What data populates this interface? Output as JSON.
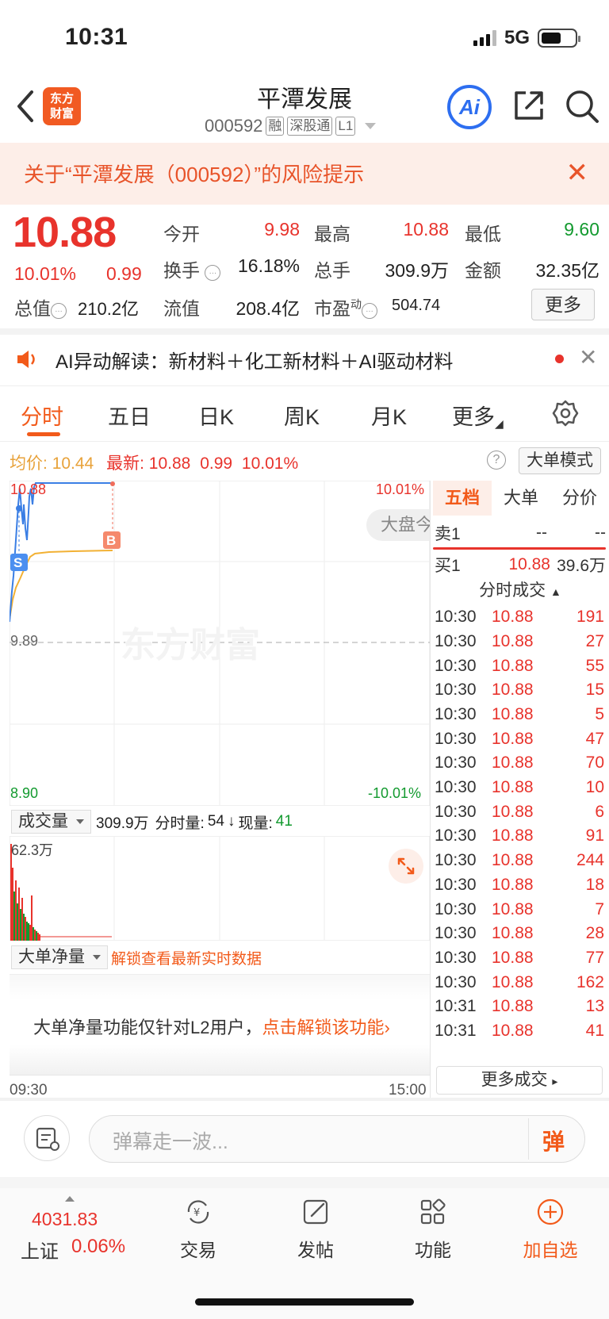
{
  "status_bar": {
    "time": "10:31",
    "network": "5G"
  },
  "header": {
    "logo": "东方财富",
    "stock_name": "平潭发展",
    "stock_code": "000592",
    "tags": [
      "融",
      "深股通",
      "L1"
    ],
    "ai_label": "Ai"
  },
  "risk_banner": {
    "text": "关于“平潭发展（000592）”的风险提示"
  },
  "quote": {
    "price": "10.88",
    "change_pct": "10.01%",
    "change": "0.99",
    "fields": [
      {
        "label": "今开",
        "value": "9.98",
        "color": "red"
      },
      {
        "label": "最高",
        "value": "10.88",
        "color": "red"
      },
      {
        "label": "最低",
        "value": "9.60",
        "color": "green"
      },
      {
        "label": "换手",
        "value": "16.18%",
        "color": "black"
      },
      {
        "label": "总手",
        "value": "309.9万",
        "color": "black"
      },
      {
        "label": "金额",
        "value": "32.35亿",
        "color": "black"
      },
      {
        "label": "总值",
        "value": "210.2亿",
        "color": "black"
      },
      {
        "label": "流值",
        "value": "208.4亿",
        "color": "black"
      },
      {
        "label": "市盈",
        "label_sup": "动",
        "value": "504.74",
        "color": "black"
      }
    ],
    "more_label": "更多"
  },
  "ai_notice": {
    "text": "AI异动解读：新材料＋化工新材料＋AI驱动材料"
  },
  "tabs": [
    "分时",
    "五日",
    "日K",
    "周K",
    "月K",
    "更多"
  ],
  "avg_row": {
    "avg_label": "均价:",
    "avg_value": "10.44",
    "latest_label": "最新:",
    "latest_value": "10.88",
    "change": "0.99",
    "change_pct": "10.01%",
    "mode_label": "大单模式"
  },
  "chart": {
    "y_top": "10.88",
    "y_mid": "9.89",
    "y_bottom": "8.90",
    "pct_top": "10.01%",
    "pct_bottom": "-10.01%",
    "watermark": "东方财富",
    "marker_b": "B",
    "marker_s": "S",
    "dapan_label": "大盘今"
  },
  "volume": {
    "selector": "成交量",
    "total": "309.9万",
    "fenshi_label": "分时量:",
    "fenshi_value": "54",
    "current_label": "现量:",
    "current_value": "41",
    "max_label": "62.3万"
  },
  "net_flow": {
    "selector": "大单净量",
    "unlock_text": "解锁查看最新实时数据",
    "l2_text": "大单净量功能仅针对L2用户，",
    "l2_link": "点击解锁该功能"
  },
  "time_axis": {
    "start": "09:30",
    "end": "15:00"
  },
  "right_panel": {
    "tabs": [
      "五档",
      "大单",
      "分价"
    ],
    "sell1": {
      "label": "卖1",
      "price": "--",
      "volume": "--"
    },
    "buy1": {
      "label": "买1",
      "price": "10.88",
      "volume": "39.6万"
    },
    "ticks_header": "分时成交",
    "ticks": [
      {
        "time": "10:30",
        "price": "10.88",
        "vol": "191"
      },
      {
        "time": "10:30",
        "price": "10.88",
        "vol": "27"
      },
      {
        "time": "10:30",
        "price": "10.88",
        "vol": "55"
      },
      {
        "time": "10:30",
        "price": "10.88",
        "vol": "15"
      },
      {
        "time": "10:30",
        "price": "10.88",
        "vol": "5"
      },
      {
        "time": "10:30",
        "price": "10.88",
        "vol": "47"
      },
      {
        "time": "10:30",
        "price": "10.88",
        "vol": "70"
      },
      {
        "time": "10:30",
        "price": "10.88",
        "vol": "10"
      },
      {
        "time": "10:30",
        "price": "10.88",
        "vol": "6"
      },
      {
        "time": "10:30",
        "price": "10.88",
        "vol": "91"
      },
      {
        "time": "10:30",
        "price": "10.88",
        "vol": "244"
      },
      {
        "time": "10:30",
        "price": "10.88",
        "vol": "18"
      },
      {
        "time": "10:30",
        "price": "10.88",
        "vol": "7"
      },
      {
        "time": "10:30",
        "price": "10.88",
        "vol": "28"
      },
      {
        "time": "10:30",
        "price": "10.88",
        "vol": "77"
      },
      {
        "time": "10:30",
        "price": "10.88",
        "vol": "162"
      },
      {
        "time": "10:31",
        "price": "10.88",
        "vol": "13"
      },
      {
        "time": "10:31",
        "price": "10.88",
        "vol": "41"
      }
    ],
    "more_ticks": "更多成交"
  },
  "danmaku": {
    "placeholder": "弹幕走一波...",
    "button": "弹"
  },
  "bottom_nav": {
    "index_value": "4031.83",
    "index_name": "上证",
    "index_pct": "0.06%",
    "items": [
      "交易",
      "发帖",
      "功能",
      "加自选"
    ]
  }
}
